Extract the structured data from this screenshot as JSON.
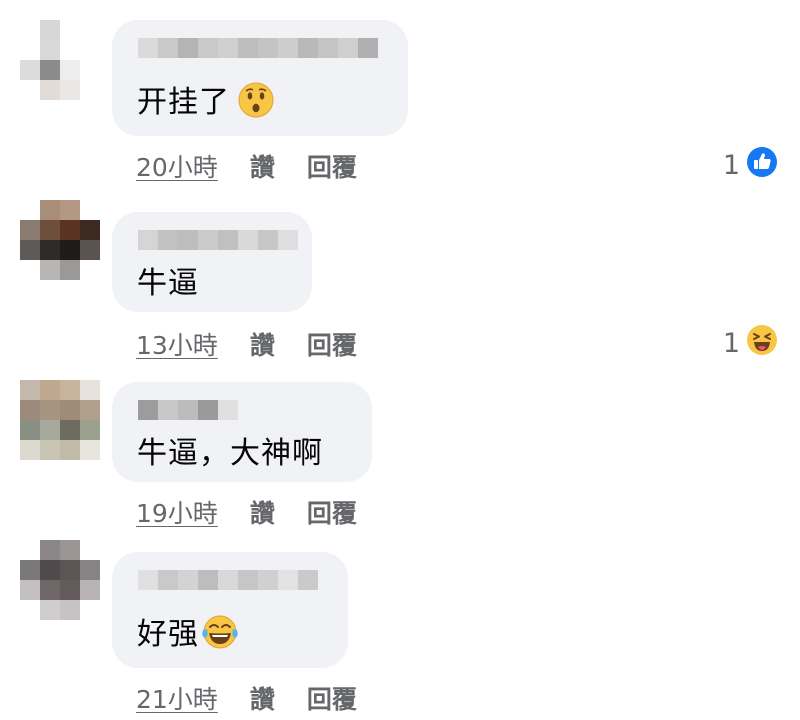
{
  "comments": [
    {
      "text": "开挂了",
      "time": "20小時",
      "like_label": "讚",
      "reply_label": "回覆",
      "reaction_count": "1",
      "reaction_type": "like-icon",
      "text_emoji": "hushed-face-icon"
    },
    {
      "text": "牛逼",
      "time": "13小時",
      "like_label": "讚",
      "reply_label": "回覆",
      "reaction_count": "1",
      "reaction_type": "haha-icon",
      "text_emoji": ""
    },
    {
      "text": "牛逼，大神啊",
      "time": "19小時",
      "like_label": "讚",
      "reply_label": "回覆",
      "reaction_count": "",
      "reaction_type": "",
      "text_emoji": ""
    },
    {
      "text": "好强",
      "time": "21小時",
      "like_label": "讚",
      "reply_label": "回覆",
      "reaction_count": "",
      "reaction_type": "",
      "text_emoji": "tears-of-joy-icon"
    }
  ],
  "colors": {
    "bubble": "#f0f2f5",
    "secondary_text": "#65676b",
    "like_blue": "#1877f2",
    "emoji_yellow": "#f7c644"
  }
}
